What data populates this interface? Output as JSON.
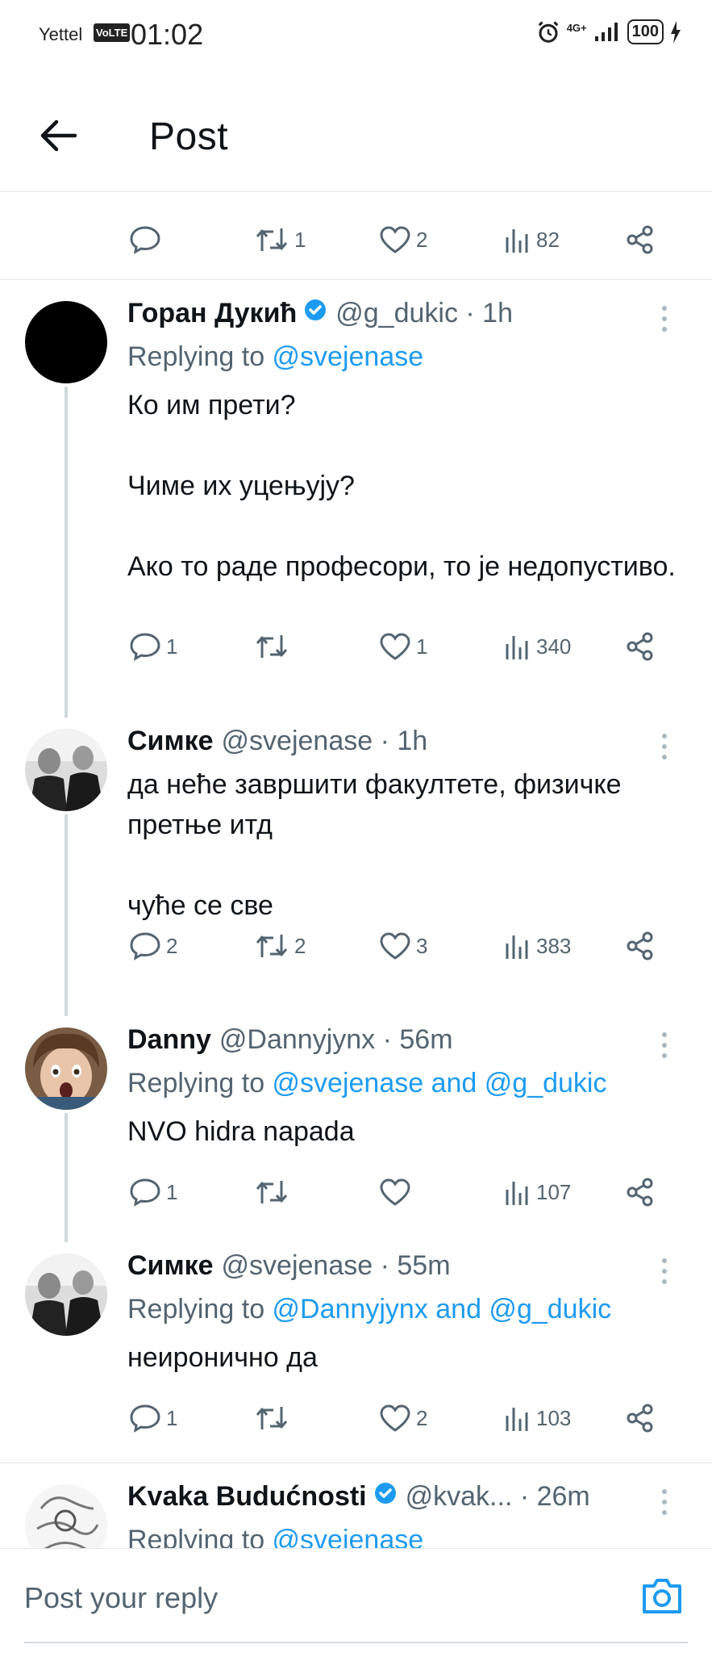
{
  "status_bar": {
    "carrier": "Yettel",
    "volte": "VoLTE",
    "time": "01:02",
    "network": "4G+",
    "battery": "100"
  },
  "header": {
    "title": "Post"
  },
  "parent_actions": {
    "replies": "",
    "retweets": "1",
    "likes": "2",
    "views": "82"
  },
  "tweets": [
    {
      "name": "Горан Дукић",
      "verified": true,
      "handle_time": "@g_dukic · 1h",
      "replying_prefix": "Replying to ",
      "replying_to": "@svejenase",
      "text": "Ко им прети?\n\nЧиме их уцењују?\n\nАко то раде професори, то је недопустиво.",
      "replies": "1",
      "retweets": "",
      "likes": "1",
      "views": "340"
    },
    {
      "name": "Симке",
      "verified": false,
      "handle_time": "@svejenase · 1h",
      "replying_prefix": "",
      "replying_to": "",
      "text": "да нeће завршити факултете, физичке претње итд\n\nчуће се све",
      "replies": "2",
      "retweets": "2",
      "likes": "3",
      "views": "383"
    },
    {
      "name": "Danny",
      "verified": false,
      "handle_time": "@Dannyjynx · 56m",
      "replying_prefix": "Replying to ",
      "replying_to": "@svejenase and @g_dukic",
      "text": "NVO hidra napada",
      "replies": "1",
      "retweets": "",
      "likes": "",
      "views": "107"
    },
    {
      "name": "Симке",
      "verified": false,
      "handle_time": "@svejenase · 55m",
      "replying_prefix": "Replying to ",
      "replying_to": "@Dannyjynx and @g_dukic",
      "text": "неиронично да",
      "replies": "1",
      "retweets": "",
      "likes": "2",
      "views": "103"
    },
    {
      "name": "Kvaka Budućnosti",
      "verified": true,
      "handle_time": "@kvak... · 26m",
      "replying_prefix": "Replying to ",
      "replying_to": "@svejenase",
      "text": ""
    }
  ],
  "reply_bar": {
    "placeholder": "Post your reply"
  },
  "colors": {
    "link": "#1d9bf0",
    "muted": "#536471",
    "text": "#0f1419",
    "divider": "#e1e6ea"
  }
}
